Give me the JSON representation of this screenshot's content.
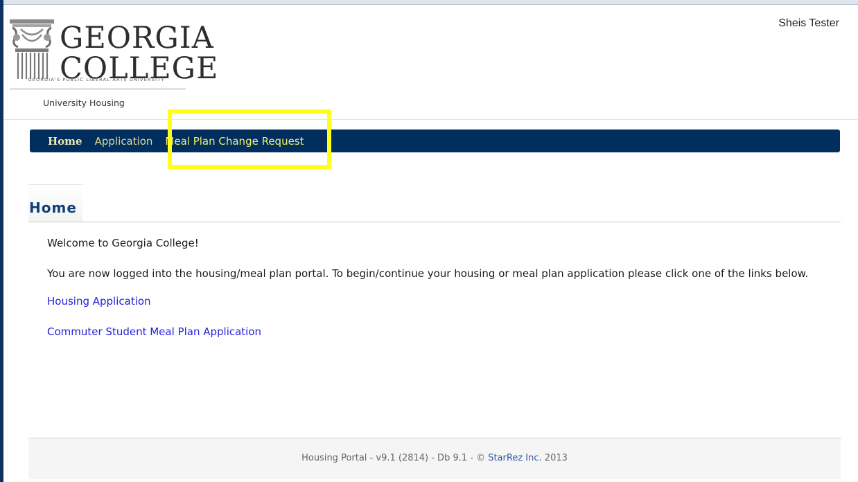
{
  "header": {
    "logo": {
      "line1": "GEORGIA",
      "line2": "COLLEGE",
      "tagline": "GEORGIA'S PUBLIC LIBERAL ARTS UNIVERSITY",
      "subtitle": "University Housing"
    },
    "user_name": "Sheis Tester"
  },
  "nav": {
    "items": [
      {
        "label": "Home"
      },
      {
        "label": "Application"
      },
      {
        "label": "Meal Plan Change Request"
      }
    ],
    "highlight_color": "#ffff1c",
    "bar_color": "#002f5f"
  },
  "main": {
    "title": "Home",
    "welcome": "Welcome to Georgia College!",
    "intro": "You are now logged into the housing/meal plan portal. To begin/continue your housing or meal plan application please click one of the links below.",
    "links": [
      {
        "label": "Housing Application"
      },
      {
        "label": "Commuter Student Meal Plan Application"
      }
    ]
  },
  "footer": {
    "prefix": "Housing Portal - v9.1 (2814) - Db 9.1 - ©",
    "company": "StarRez Inc.",
    "year": "2013"
  }
}
